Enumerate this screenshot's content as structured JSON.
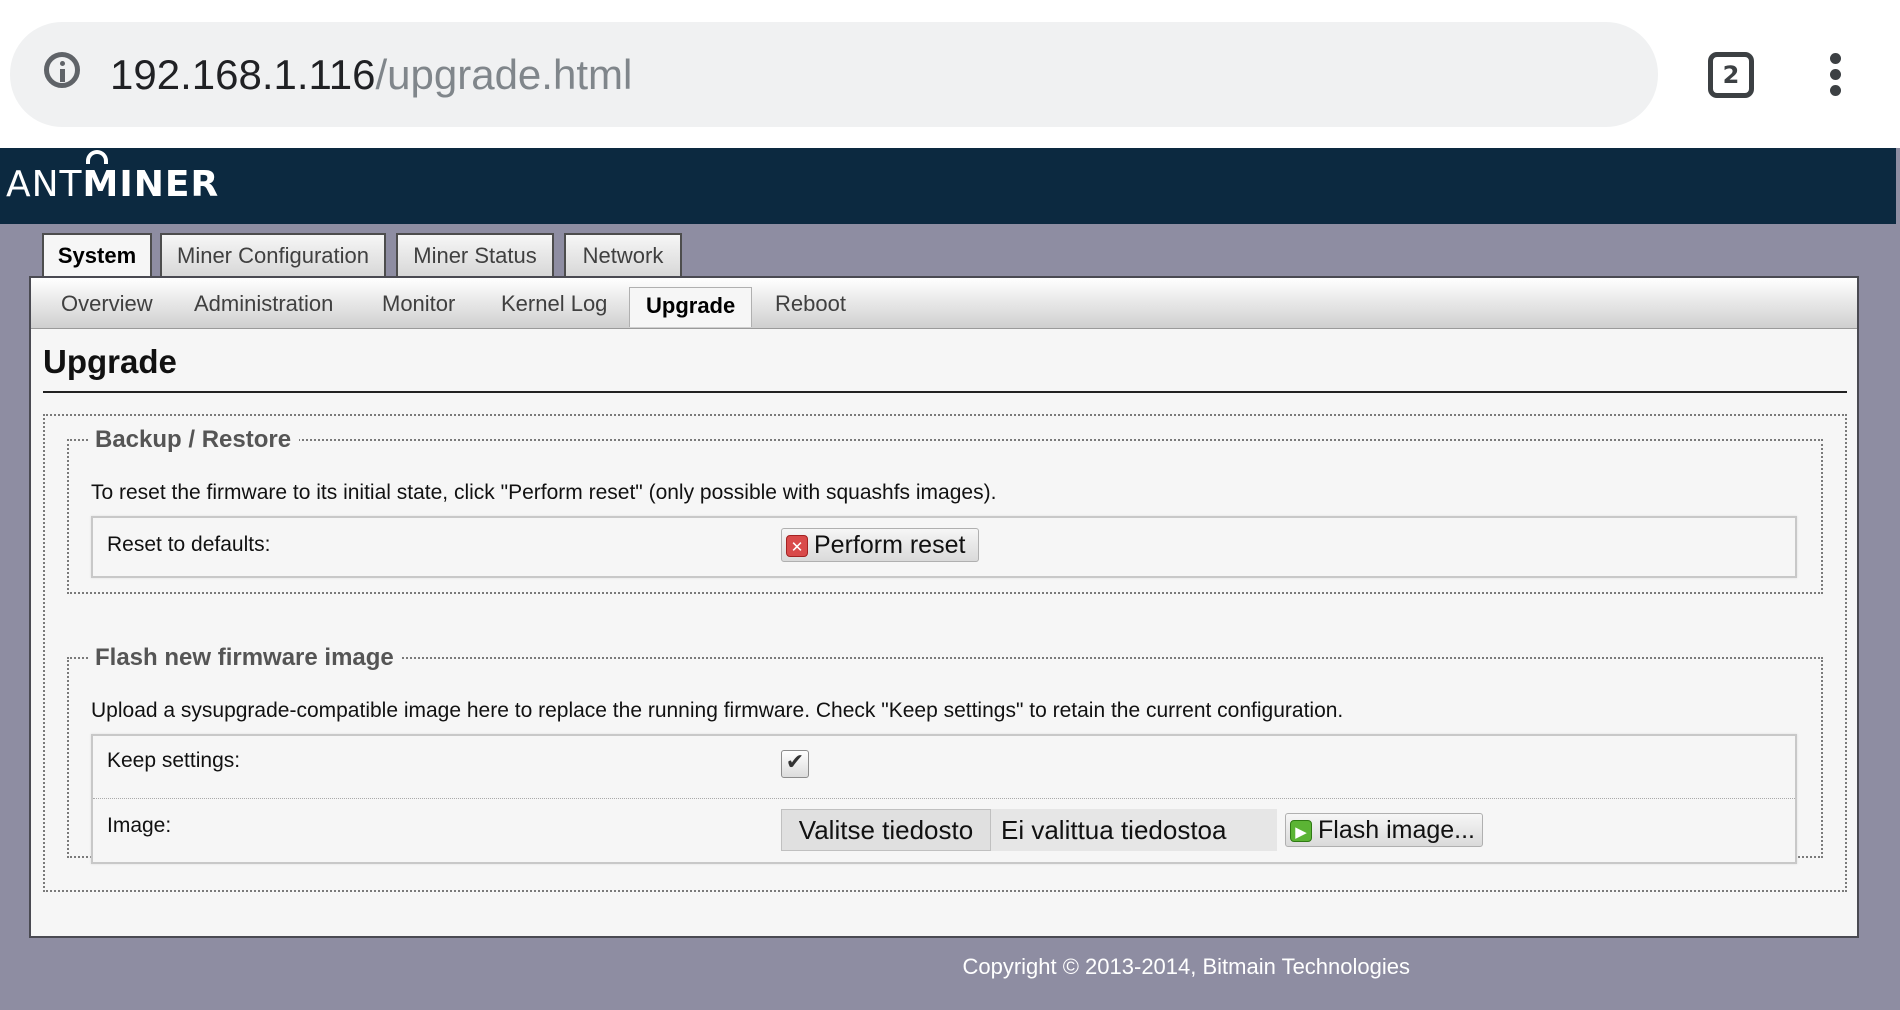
{
  "browser": {
    "url_host": "192.168.1.116",
    "url_path": "/upgrade.html",
    "tab_count": "2"
  },
  "header": {
    "logo_ant": "ANT",
    "logo_miner": "MINER"
  },
  "main_tabs": [
    {
      "label": "System",
      "active": true
    },
    {
      "label": "Miner Configuration",
      "active": false
    },
    {
      "label": "Miner Status",
      "active": false
    },
    {
      "label": "Network",
      "active": false
    }
  ],
  "sub_tabs": [
    {
      "label": "Overview",
      "active": false
    },
    {
      "label": "Administration",
      "active": false
    },
    {
      "label": "Monitor",
      "active": false
    },
    {
      "label": "Kernel Log",
      "active": false
    },
    {
      "label": "Upgrade",
      "active": true
    },
    {
      "label": "Reboot",
      "active": false
    }
  ],
  "page_title": "Upgrade",
  "backup_restore": {
    "legend": "Backup / Restore",
    "description": "To reset the firmware to its initial state, click \"Perform reset\" (only possible with squashfs images).",
    "reset_label": "Reset to defaults:",
    "reset_button": "Perform reset"
  },
  "flash": {
    "legend": "Flash new firmware image",
    "description": "Upload a sysupgrade-compatible image here to replace the running firmware. Check \"Keep settings\" to retain the current configuration.",
    "keep_settings_label": "Keep settings:",
    "keep_settings_checked": true,
    "image_label": "Image:",
    "choose_file_button": "Valitse tiedosto",
    "no_file_text": "Ei valittua tiedostoa",
    "flash_button": "Flash image..."
  },
  "footer": "Copyright © 2013-2014, Bitmain Technologies",
  "colors": {
    "header_bg": "#0c2940",
    "page_bg": "#8e8da2",
    "panel_bg": "#f6f6f6"
  },
  "icons": {
    "reset": "reset-icon",
    "flash": "flash-icon",
    "info": "info-icon",
    "menu": "more-vert-icon"
  }
}
